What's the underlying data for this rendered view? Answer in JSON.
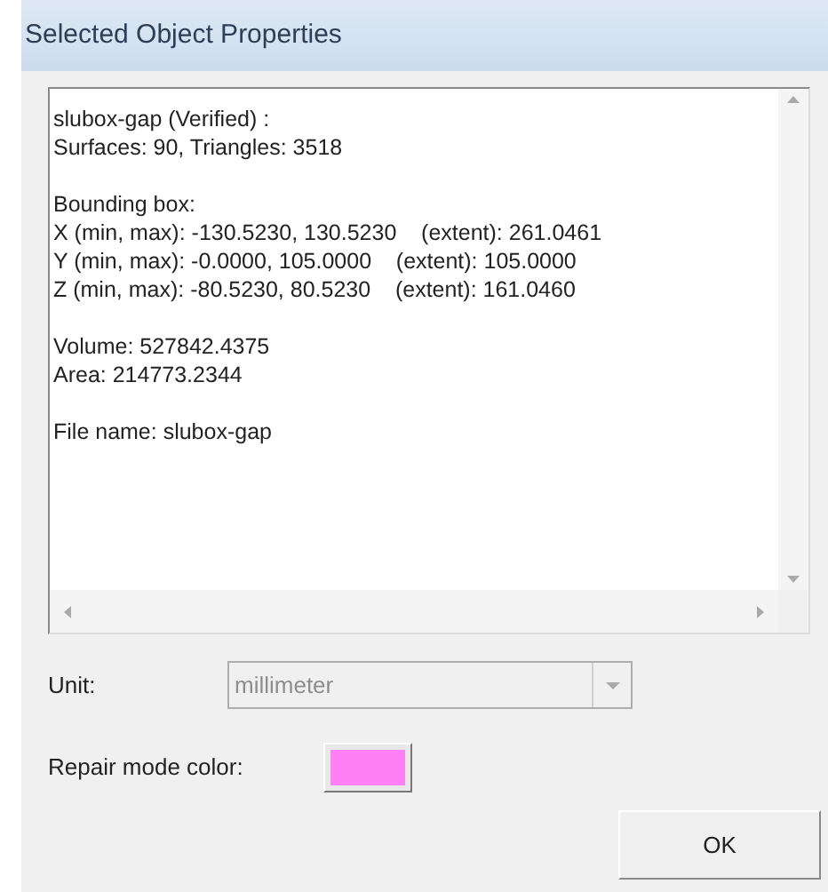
{
  "window": {
    "title": "Selected Object Properties"
  },
  "info": {
    "paragraphs": [
      [
        "slubox-gap (Verified) :",
        "Surfaces: 90, Triangles: 3518"
      ],
      [
        "Bounding box:",
        "X (min, max): -130.5230, 130.5230    (extent): 261.0461",
        "Y (min, max): -0.0000, 105.0000    (extent): 105.0000",
        "Z (min, max): -80.5230, 80.5230    (extent): 161.0460"
      ],
      [
        "Volume: 527842.4375",
        "Area: 214773.2344"
      ],
      [
        "File name: slubox-gap"
      ]
    ]
  },
  "unit": {
    "label": "Unit:",
    "value": "millimeter",
    "disabled": true
  },
  "repair_color": {
    "label": "Repair mode color:",
    "color": "#ff80f4"
  },
  "buttons": [
    "OK"
  ]
}
